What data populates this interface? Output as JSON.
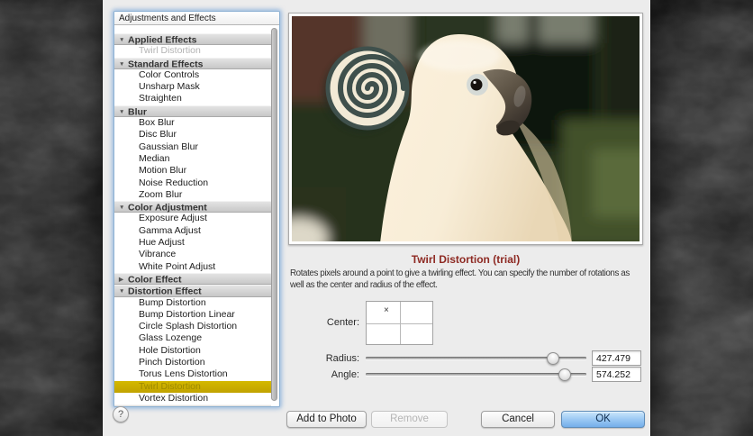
{
  "sidebar": {
    "header": "Adjustments and Effects",
    "rows": [
      {
        "type": "group",
        "label": "Applied Effects",
        "disclosure": "down"
      },
      {
        "type": "item",
        "label": "Twirl Distortion",
        "state": "dimmed"
      },
      {
        "type": "group",
        "label": "Standard Effects",
        "disclosure": "down"
      },
      {
        "type": "item",
        "label": "Color Controls"
      },
      {
        "type": "item",
        "label": "Unsharp Mask"
      },
      {
        "type": "item",
        "label": "Straighten"
      },
      {
        "type": "group",
        "label": "Blur",
        "disclosure": "down"
      },
      {
        "type": "item",
        "label": "Box Blur"
      },
      {
        "type": "item",
        "label": "Disc Blur"
      },
      {
        "type": "item",
        "label": "Gaussian Blur"
      },
      {
        "type": "item",
        "label": "Median"
      },
      {
        "type": "item",
        "label": "Motion Blur"
      },
      {
        "type": "item",
        "label": "Noise Reduction"
      },
      {
        "type": "item",
        "label": "Zoom Blur"
      },
      {
        "type": "group",
        "label": "Color Adjustment",
        "disclosure": "down"
      },
      {
        "type": "item",
        "label": "Exposure Adjust"
      },
      {
        "type": "item",
        "label": "Gamma Adjust"
      },
      {
        "type": "item",
        "label": "Hue Adjust"
      },
      {
        "type": "item",
        "label": "Vibrance"
      },
      {
        "type": "item",
        "label": "White Point Adjust"
      },
      {
        "type": "group",
        "label": "Color Effect",
        "disclosure": "right"
      },
      {
        "type": "group",
        "label": "Distortion Effect",
        "disclosure": "down"
      },
      {
        "type": "item",
        "label": "Bump Distortion"
      },
      {
        "type": "item",
        "label": "Bump Distortion Linear"
      },
      {
        "type": "item",
        "label": "Circle Splash Distortion"
      },
      {
        "type": "item",
        "label": "Glass Lozenge"
      },
      {
        "type": "item",
        "label": "Hole Distortion"
      },
      {
        "type": "item",
        "label": "Pinch Distortion"
      },
      {
        "type": "item",
        "label": "Torus Lens Distortion"
      },
      {
        "type": "item",
        "label": "Twirl Distortion",
        "state": "selected"
      },
      {
        "type": "item",
        "label": "Vortex Distortion"
      },
      {
        "type": "group",
        "label": "",
        "disclosure": "none",
        "partial": true
      }
    ]
  },
  "preview": {
    "subject": "white cockatoo with twirl-distorted spiral crest against dark foliage"
  },
  "effect": {
    "title": "Twirl Distortion (trial)",
    "description": "Rotates pixels around a point to give a twirling effect. You can specify the number of rotations as well as the center and radius of the effect.",
    "description_lines": [
      "Rotates pixels around a point to give a twirling effect. You can specify the number of rotations as",
      "well as the center and radius of the effect."
    ],
    "center": {
      "label": "Center:",
      "marker": "×"
    },
    "sliders": [
      {
        "label": "Radius:",
        "value": "427.479",
        "position_pct": 85
      },
      {
        "label": "Angle:",
        "value": "574.252",
        "position_pct": 90
      }
    ]
  },
  "footer": {
    "help": "?",
    "add_to_photo": "Add to Photo",
    "remove": "Remove",
    "cancel": "Cancel",
    "ok": "OK"
  },
  "colors": {
    "selection_gold": "#c9ad00",
    "title_red": "#8e2a23",
    "ok_button_blue": "#9cc9f3",
    "focus_ring_blue": "#6098d6"
  }
}
